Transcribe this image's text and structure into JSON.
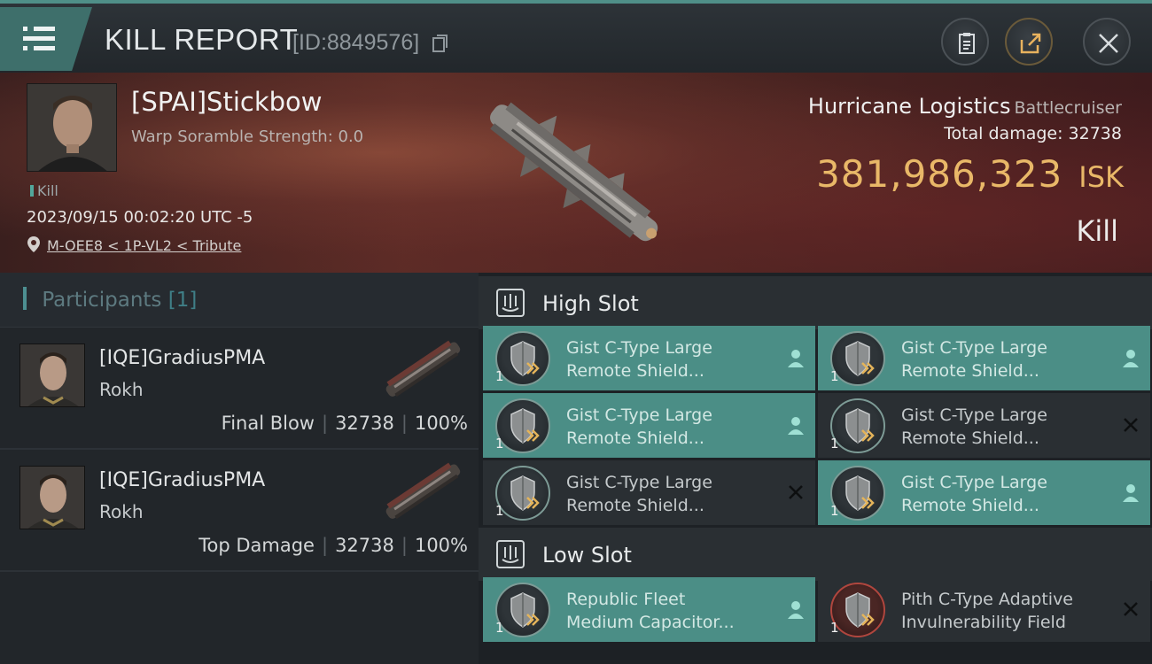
{
  "header": {
    "title": "KILL REPORT",
    "report_id": "[ID:8849576]"
  },
  "victim": {
    "name": "[SPAI]Stickbow",
    "warp_scramble": "Warp Soramble Strength: 0.0",
    "kill_tag": "Kill",
    "datetime": "2023/09/15 00:02:20 UTC -5",
    "location": "M-OEE8 < 1P-VL2 < Tribute",
    "ship_name": "Hurricane Logistics",
    "ship_class": "Battlecruiser",
    "total_damage_label": "Total damage:",
    "total_damage_value": "32738",
    "isk_value": "381,986,323",
    "isk_unit": "ISK",
    "result": "Kill"
  },
  "participants": {
    "label": "Participants",
    "count": "[1]",
    "rows": [
      {
        "name": "[IQE]GradiusPMA",
        "ship": "Rokh",
        "role": "Final Blow",
        "damage": "32738",
        "percent": "100%"
      },
      {
        "name": "[IQE]GradiusPMA",
        "ship": "Rokh",
        "role": "Top Damage",
        "damage": "32738",
        "percent": "100%"
      }
    ]
  },
  "high_slot": {
    "title": "High Slot",
    "modules": [
      {
        "line1": "Gist C-Type Large",
        "line2": "Remote Shield...",
        "qty": "1",
        "status": "person-icon",
        "active": true
      },
      {
        "line1": "Gist C-Type Large",
        "line2": "Remote Shield...",
        "qty": "1",
        "status": "person-icon",
        "active": true
      },
      {
        "line1": "Gist C-Type Large",
        "line2": "Remote Shield...",
        "qty": "1",
        "status": "person-icon",
        "active": true
      },
      {
        "line1": "Gist C-Type Large",
        "line2": "Remote Shield...",
        "qty": "1",
        "status": "close-icon",
        "active": false
      },
      {
        "line1": "Gist C-Type Large",
        "line2": "Remote Shield...",
        "qty": "1",
        "status": "close-icon",
        "active": false
      },
      {
        "line1": "Gist C-Type Large",
        "line2": "Remote Shield...",
        "qty": "1",
        "status": "person-icon",
        "active": true
      }
    ]
  },
  "low_slot": {
    "title": "Low Slot",
    "modules": [
      {
        "line1": "Republic Fleet",
        "line2": "Medium Capacitor...",
        "qty": "1",
        "status": "person-icon",
        "active": true
      },
      {
        "line1": "Pith C-Type Adaptive",
        "line2": "Invulnerability Field",
        "qty": "1",
        "status": "close-icon",
        "active": false
      }
    ]
  },
  "colors": {
    "accent_teal": "#4b8e86",
    "isk_gold": "#e9b868",
    "banner_red": "#5a2c26"
  }
}
